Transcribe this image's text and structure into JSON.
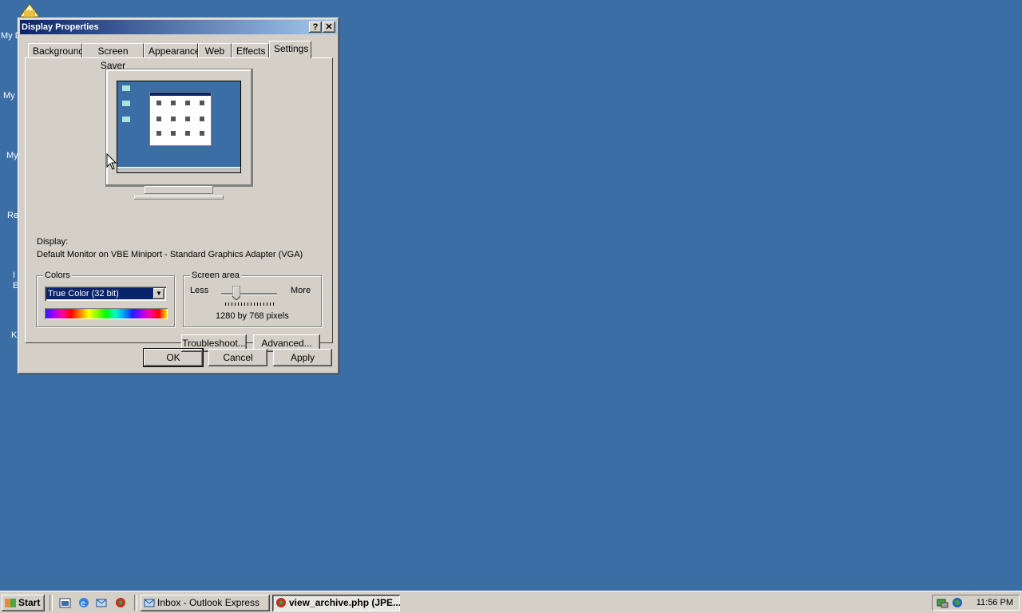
{
  "desktop": {
    "icon_labels": [
      "My D",
      "My",
      "My",
      "Re",
      "I",
      "E",
      "K"
    ]
  },
  "window": {
    "title": "Display Properties",
    "help_button": "?",
    "close_button": "✕",
    "tabs": [
      {
        "label": "Background"
      },
      {
        "label": "Screen Saver"
      },
      {
        "label": "Appearance"
      },
      {
        "label": "Web"
      },
      {
        "label": "Effects"
      },
      {
        "label": "Settings",
        "active": true
      }
    ],
    "display_label": "Display:",
    "display_value": "Default Monitor on VBE Miniport - Standard Graphics Adapter (VGA)",
    "colors": {
      "group_label": "Colors",
      "selected": "True Color (32 bit)"
    },
    "screen_area": {
      "group_label": "Screen area",
      "less": "Less",
      "more": "More",
      "resolution": "1280 by 768 pixels",
      "slider_position": 0.3
    },
    "troubleshoot_button": "Troubleshoot...",
    "advanced_button": "Advanced...",
    "ok_button": "OK",
    "cancel_button": "Cancel",
    "apply_button": "Apply"
  },
  "taskbar": {
    "start_label": "Start",
    "tasks": [
      {
        "label": "Inbox - Outlook Express",
        "icon": "outlook-express-icon"
      },
      {
        "label": "view_archive.php (JPE...",
        "icon": "browser-icon",
        "active": true
      }
    ],
    "clock": "11:56 PM"
  },
  "colors": {
    "desktop": "#3a6ea5",
    "title_active": "#0a246a",
    "face": "#d4d0c8"
  }
}
